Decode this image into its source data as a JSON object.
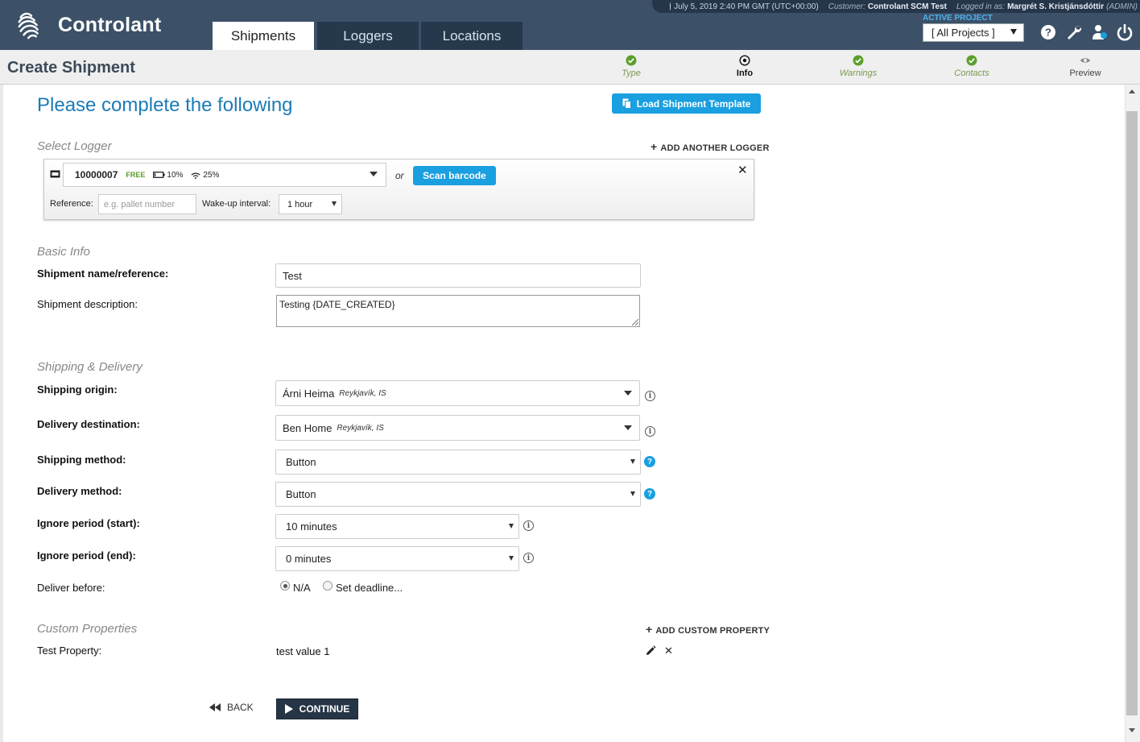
{
  "brand": {
    "name": "Controlant"
  },
  "nav": {
    "tabs": [
      {
        "label": "Shipments"
      },
      {
        "label": "Loggers"
      },
      {
        "label": "Locations"
      }
    ]
  },
  "session": {
    "datetime": "July 5, 2019 2:40 PM GMT (UTC+00:00)",
    "customer_label": "Customer:",
    "customer": "Controlant SCM Test",
    "logged_label": "Logged in as:",
    "user": "Margrét S. Kristjánsdóttir",
    "role": "(ADMIN)"
  },
  "project": {
    "label": "ACTIVE PROJECT",
    "value": "[ All Projects ]"
  },
  "page": {
    "title": "Create Shipment"
  },
  "wizard": {
    "steps": [
      {
        "label": "Type",
        "state": "done"
      },
      {
        "label": "Info",
        "state": "current"
      },
      {
        "label": "Warnings",
        "state": "done"
      },
      {
        "label": "Contacts",
        "state": "done"
      },
      {
        "label": "Preview",
        "state": "todo"
      }
    ]
  },
  "form": {
    "heading": "Please complete the following",
    "template_button": "Load Shipment Template",
    "logger_section": {
      "title": "Select Logger",
      "add_label": "ADD ANOTHER LOGGER",
      "logger_id": "10000007",
      "status": "FREE",
      "battery": "10%",
      "signal": "25%",
      "or": "or",
      "scan_button": "Scan barcode",
      "reference_label": "Reference:",
      "reference_placeholder": "e.g. pallet number",
      "wakeup_label": "Wake-up interval:",
      "wakeup_value": "1 hour"
    },
    "basic_info": {
      "title": "Basic Info",
      "name_label": "Shipment name/reference:",
      "name_value": "Test",
      "desc_label": "Shipment description:",
      "desc_value": "Testing {DATE_CREATED}"
    },
    "shipping": {
      "title": "Shipping & Delivery",
      "origin_label": "Shipping origin:",
      "origin_value": "Árni Heima",
      "origin_sub": "Reykjavík, IS",
      "dest_label": "Delivery destination:",
      "dest_value": "Ben Home",
      "dest_sub": "Reykjavík, IS",
      "ship_method_label": "Shipping method:",
      "ship_method_value": "Button",
      "deliv_method_label": "Delivery method:",
      "deliv_method_value": "Button",
      "ignore_start_label": "Ignore period (start):",
      "ignore_start_value": "10 minutes",
      "ignore_end_label": "Ignore period (end):",
      "ignore_end_value": "0 minutes",
      "deliver_before_label": "Deliver before:",
      "opt_na": "N/A",
      "opt_deadline": "Set deadline..."
    },
    "custom": {
      "title": "Custom Properties",
      "add_label": "ADD CUSTOM PROPERTY",
      "prop_label": "Test Property:",
      "prop_value": "test value 1"
    },
    "buttons": {
      "back": "BACK",
      "continue": "CONTINUE"
    }
  },
  "colors": {
    "topbar": "#3c5168",
    "accent": "#1a9fe0",
    "heading": "#1c7bb5",
    "step_done": "#5aa02c"
  }
}
